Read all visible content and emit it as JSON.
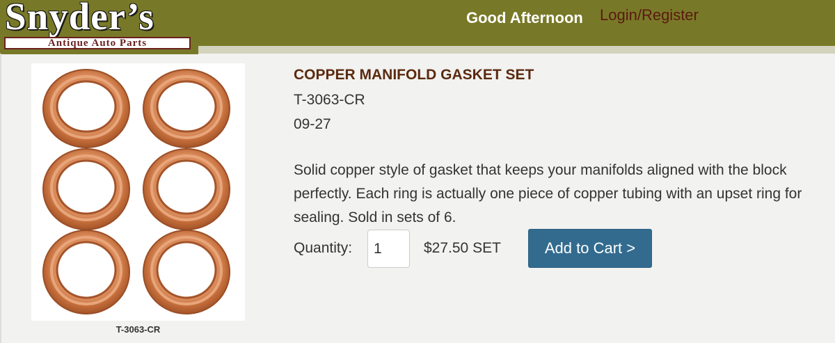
{
  "header": {
    "logo_main": "Snyder’s",
    "logo_sub": "Antique Auto Parts",
    "greeting": "Good Afternoon",
    "login_link": "Login/Register",
    "bar_color": "#787928"
  },
  "product": {
    "image_icon": "copper-gasket-rings-photo",
    "image_caption": "T-3063-CR",
    "title": "COPPER MANIFOLD GASKET SET",
    "sku": "T-3063-CR",
    "years": "09-27",
    "description": "Solid copper style of gasket that keeps your manifolds aligned with the block perfectly. Each ring is actually one piece of copper tubing with an upset ring for sealing. Sold in sets of 6.",
    "quantity_label": "Quantity:",
    "quantity_value": "1",
    "price": "$27.50 SET",
    "add_to_cart_label": "Add to Cart >",
    "button_color": "#336b8f"
  }
}
